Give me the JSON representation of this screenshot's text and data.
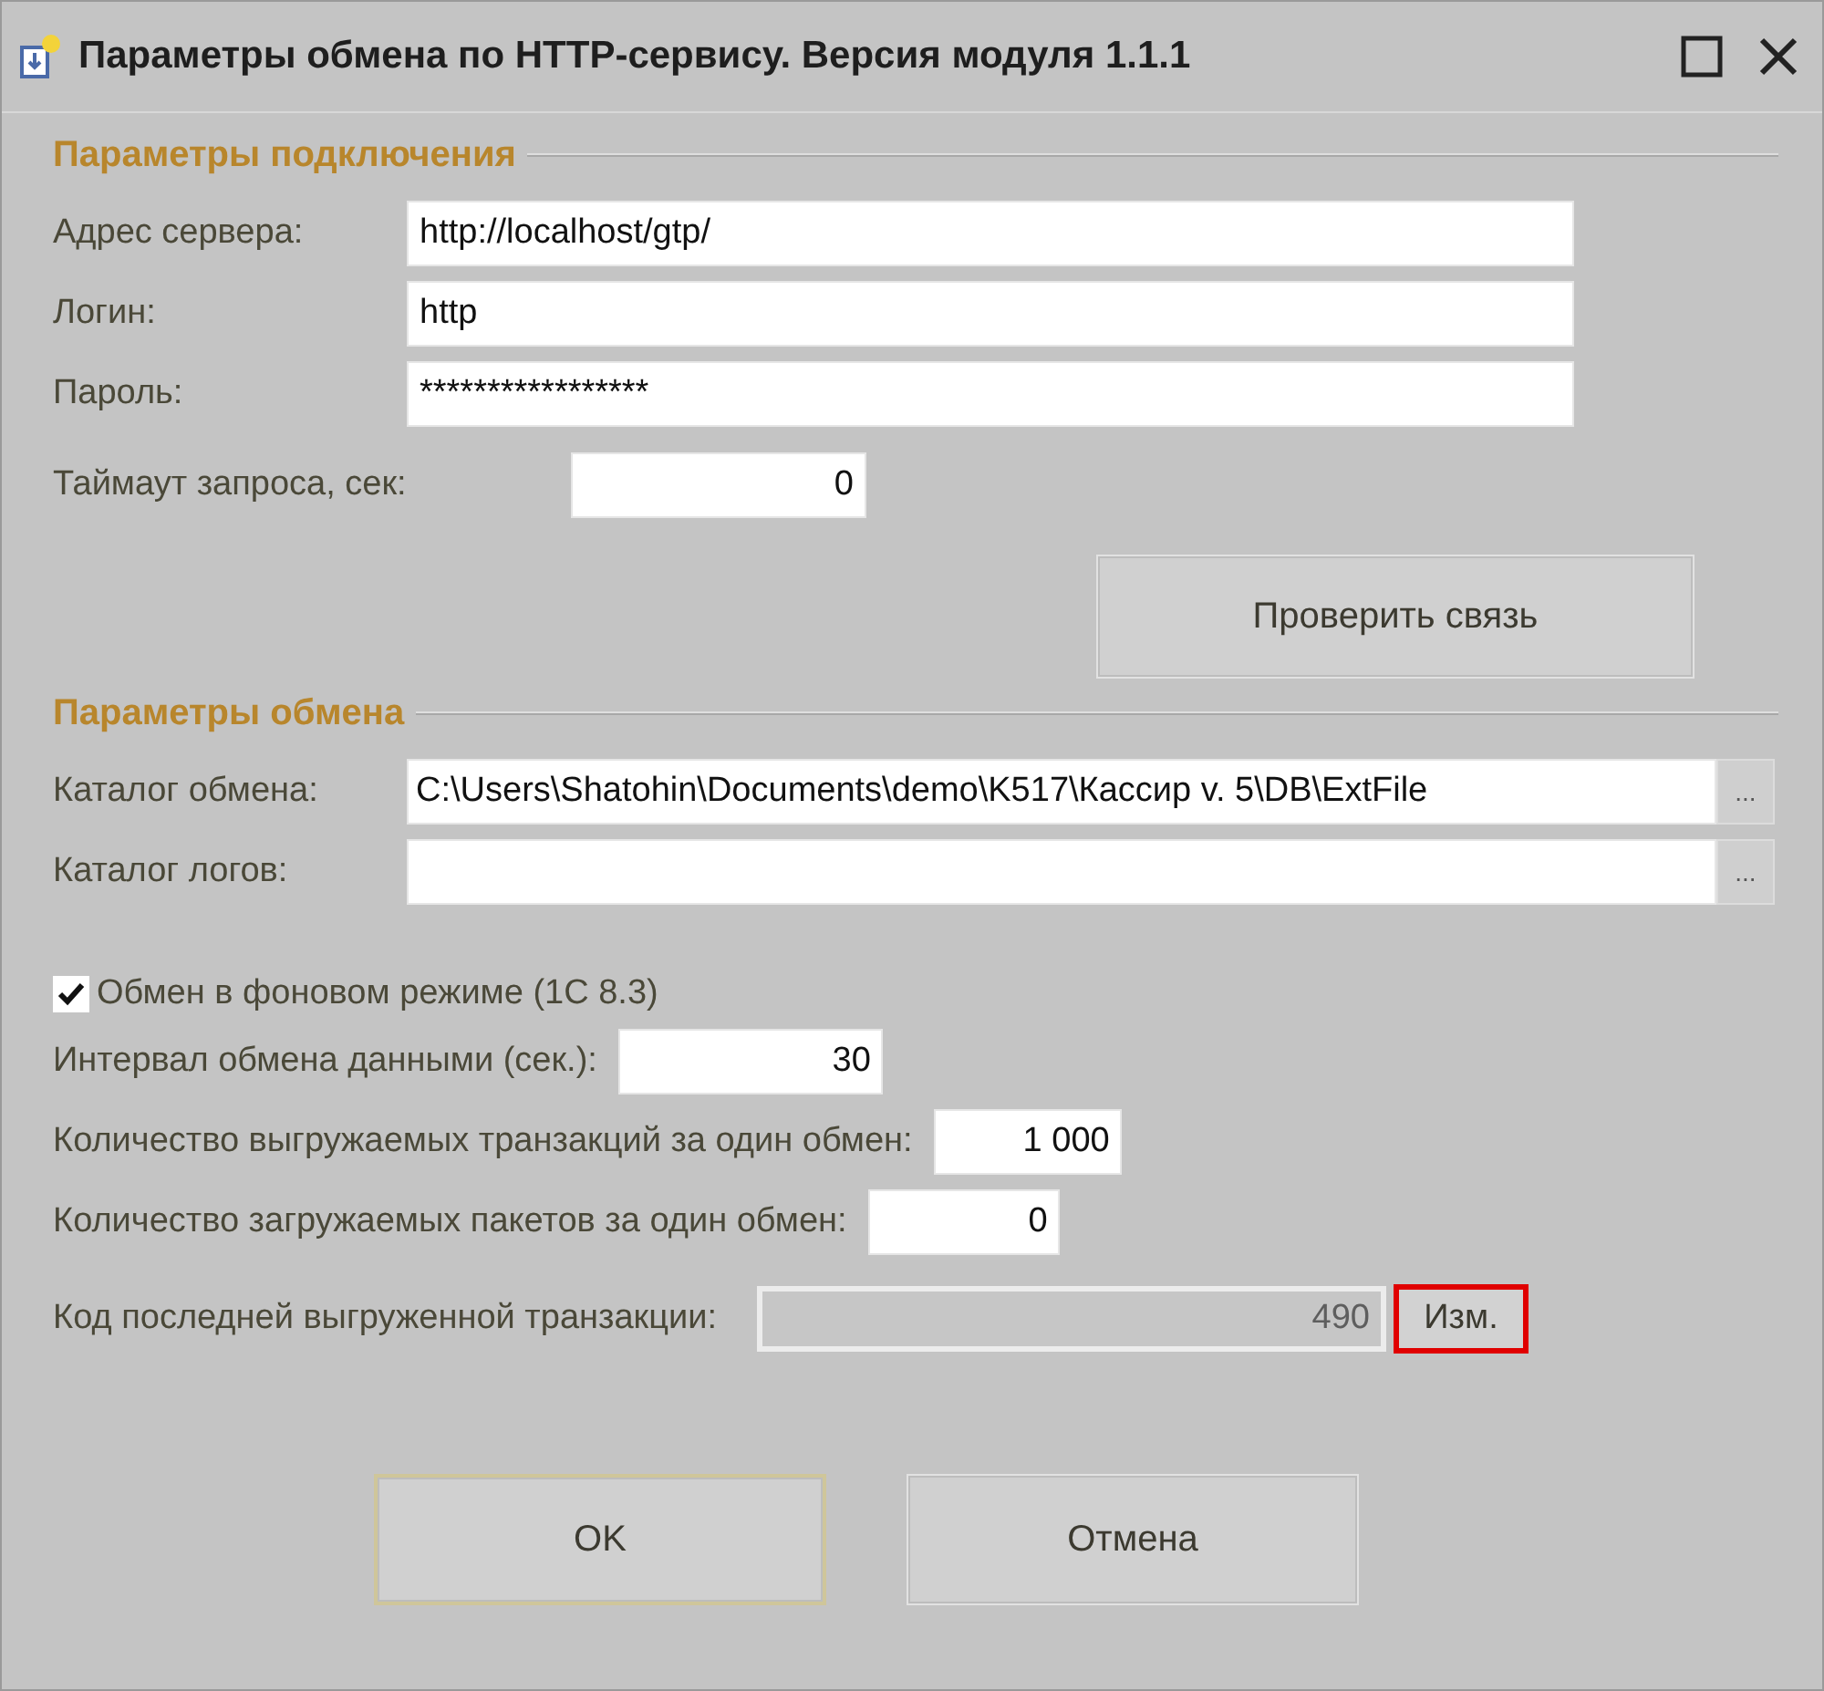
{
  "window": {
    "title": "Параметры обмена по HTTP-сервису. Версия модуля 1.1.1"
  },
  "connection": {
    "title": "Параметры подключения",
    "fields": [
      {
        "label": "Адрес сервера:",
        "value": "http://localhost/gtp/"
      },
      {
        "label": "Логин:",
        "value": "http"
      },
      {
        "label": "Пароль:",
        "value": "*****************"
      }
    ],
    "timeout": {
      "label": "Таймаут запроса, сек:",
      "value": "0"
    },
    "check_button": "Проверить связь"
  },
  "exchange": {
    "title": "Параметры обмена",
    "folders": [
      {
        "label": "Каталог обмена:",
        "value": "C:\\Users\\Shatohin\\Documents\\demo\\K517\\Кассир v. 5\\DB\\ExtFile",
        "button": "..."
      },
      {
        "label": "Каталог логов:",
        "button": "..."
      }
    ],
    "background": {
      "label": "Обмен в фоновом режиме (1С 8.3)",
      "checked": true
    },
    "numbers": [
      {
        "label": "Интервал обмена данными (сек.):",
        "value": "30"
      },
      {
        "label": "Количество выгружаемых транзакций за один обмен:",
        "value": "1 000"
      },
      {
        "label": "Количество загружаемых пакетов за один обмен:",
        "value": "0"
      }
    ],
    "last_transaction": {
      "label": "Код последней выгруженной транзакции:",
      "value": "490",
      "disabled": true,
      "button": "Изм.",
      "highlighted": true
    }
  },
  "buttons": [
    {
      "label": "OK",
      "default": true
    },
    {
      "label": "Отмена",
      "default": false
    }
  ]
}
